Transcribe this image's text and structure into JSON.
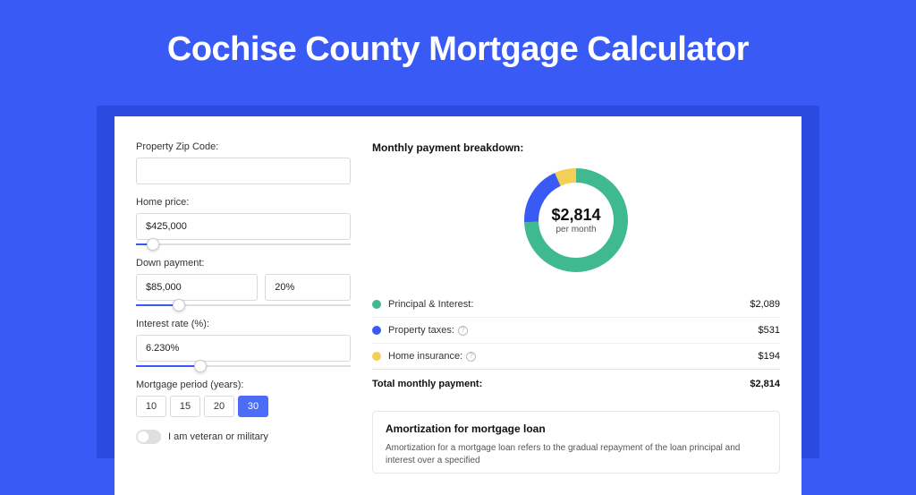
{
  "title": "Cochise County Mortgage Calculator",
  "form": {
    "zip_label": "Property Zip Code:",
    "zip_value": "",
    "price_label": "Home price:",
    "price_value": "$425,000",
    "price_slider_pct": 8,
    "down_label": "Down payment:",
    "down_value": "$85,000",
    "down_pct": "20%",
    "down_slider_pct": 20,
    "rate_label": "Interest rate (%):",
    "rate_value": "6.230%",
    "rate_slider_pct": 30,
    "period_label": "Mortgage period (years):",
    "periods": [
      "10",
      "15",
      "20",
      "30"
    ],
    "period_selected": "30",
    "vet_label": "I am veteran or military"
  },
  "breakdown": {
    "title": "Monthly payment breakdown:",
    "center_value": "$2,814",
    "center_sub": "per month",
    "items": [
      {
        "label": "Principal & Interest:",
        "amount": "$2,089",
        "color": "#3fb98f",
        "has_help": false
      },
      {
        "label": "Property taxes:",
        "amount": "$531",
        "color": "#3a5af5",
        "has_help": true
      },
      {
        "label": "Home insurance:",
        "amount": "$194",
        "color": "#f3cf55",
        "has_help": true
      }
    ],
    "total_label": "Total monthly payment:",
    "total_amount": "$2,814"
  },
  "chart_data": {
    "type": "pie",
    "title": "Monthly payment breakdown",
    "series": [
      {
        "name": "Principal & Interest",
        "value": 2089,
        "color": "#3fb98f"
      },
      {
        "name": "Property taxes",
        "value": 531,
        "color": "#3a5af5"
      },
      {
        "name": "Home insurance",
        "value": 194,
        "color": "#f3cf55"
      }
    ],
    "total": 2814
  },
  "amort": {
    "title": "Amortization for mortgage loan",
    "text": "Amortization for a mortgage loan refers to the gradual repayment of the loan principal and interest over a specified"
  }
}
